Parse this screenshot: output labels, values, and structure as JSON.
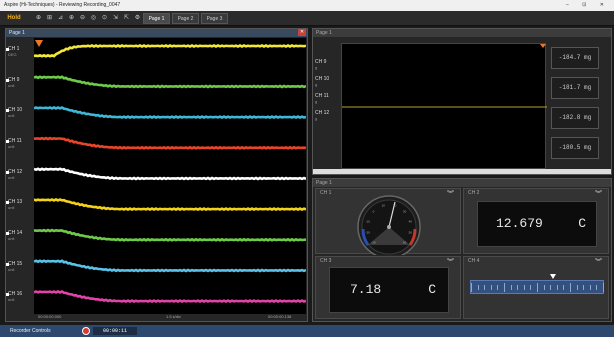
{
  "window": {
    "title": "Aspire (Hi-Techniques) - Reviewing Recording_0047",
    "controls": "–  ⊡  ✕"
  },
  "toolbar": {
    "hold_label": "Hold",
    "pages": [
      "Page 1",
      "Page 2",
      "Page 3"
    ],
    "active_page": 0
  },
  "left_panel": {
    "title": "Page 1",
    "channels": [
      {
        "name": "CH 1",
        "unit": "DEG",
        "color": "#f0e83a"
      },
      {
        "name": "CH 9",
        "unit": "unit",
        "color": "#6ecb4a"
      },
      {
        "name": "CH 10",
        "unit": "unit",
        "color": "#3fb8d8"
      },
      {
        "name": "CH 11",
        "unit": "unit",
        "color": "#e8452a"
      },
      {
        "name": "CH 12",
        "unit": "unit",
        "color": "#ffffff"
      },
      {
        "name": "CH 13",
        "unit": "unit",
        "color": "#f2d21a"
      },
      {
        "name": "CH 14",
        "unit": "unit",
        "color": "#6ecb4a"
      },
      {
        "name": "CH 15",
        "unit": "unit",
        "color": "#59c2e6"
      },
      {
        "name": "CH 16",
        "unit": "unit",
        "color": "#e044a8"
      }
    ],
    "x_start": "00:00:00.000",
    "x_div": "1.5 s/div",
    "x_end": "00:00:00.138"
  },
  "right_top_panel": {
    "title": "Page 1",
    "channels": [
      {
        "name": "CH 9",
        "unit": "g"
      },
      {
        "name": "CH 10",
        "unit": "g"
      },
      {
        "name": "CH 11",
        "unit": "g"
      },
      {
        "name": "CH 12",
        "unit": "g"
      }
    ],
    "values": [
      "-184.7  mg",
      "-181.7  mg",
      "-182.8  mg",
      "-180.5  mg"
    ]
  },
  "right_bottom_panel": {
    "title": "Page 1",
    "meters": [
      {
        "title": "CH 1",
        "scale": [
          "-30",
          "-20",
          "-10",
          "0",
          "10",
          "20",
          "30",
          "40",
          "50",
          "60"
        ]
      },
      {
        "title": "CH 2",
        "value": "12.679",
        "unit": "C"
      },
      {
        "title": "CH 3",
        "value": "7.18",
        "unit": "C"
      },
      {
        "title": "CH 4",
        "level_fraction": 0.62
      }
    ]
  },
  "status": {
    "label": "Recorder Controls",
    "time": "00:00:11"
  }
}
